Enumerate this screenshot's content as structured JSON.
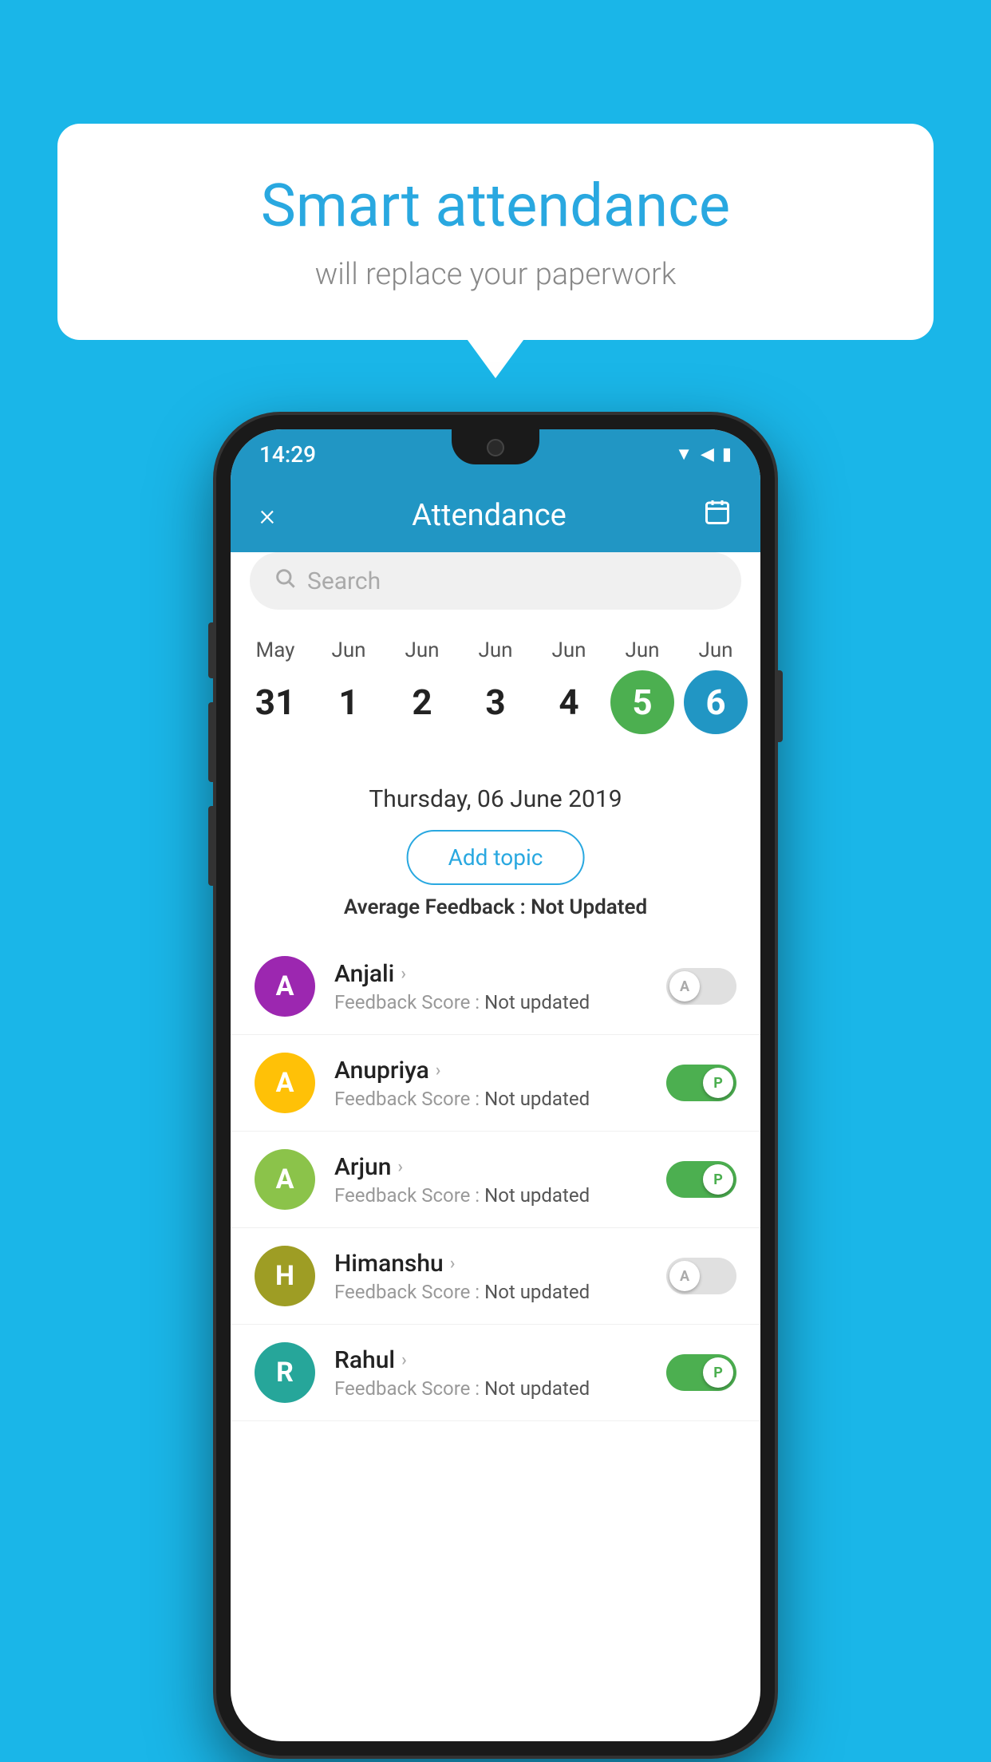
{
  "background_color": "#1ab6e8",
  "bubble": {
    "title": "Smart attendance",
    "subtitle": "will replace your paperwork"
  },
  "status_bar": {
    "time": "14:29",
    "icons": [
      "wifi",
      "signal",
      "battery"
    ]
  },
  "header": {
    "title": "Attendance",
    "close_label": "×"
  },
  "search": {
    "placeholder": "Search"
  },
  "calendar": {
    "days": [
      {
        "month": "May",
        "num": "31",
        "style": "normal"
      },
      {
        "month": "Jun",
        "num": "1",
        "style": "normal"
      },
      {
        "month": "Jun",
        "num": "2",
        "style": "normal"
      },
      {
        "month": "Jun",
        "num": "3",
        "style": "normal"
      },
      {
        "month": "Jun",
        "num": "4",
        "style": "normal"
      },
      {
        "month": "Jun",
        "num": "5",
        "style": "green"
      },
      {
        "month": "Jun",
        "num": "6",
        "style": "blue"
      }
    ]
  },
  "selected_date": "Thursday, 06 June 2019",
  "add_topic_label": "Add topic",
  "avg_feedback_label": "Average Feedback :",
  "avg_feedback_value": "Not Updated",
  "students": [
    {
      "name": "Anjali",
      "initial": "A",
      "avatar_color": "purple",
      "feedback_label": "Feedback Score :",
      "feedback_value": "Not updated",
      "toggle": "off",
      "toggle_label": "A"
    },
    {
      "name": "Anupriya",
      "initial": "A",
      "avatar_color": "yellow",
      "feedback_label": "Feedback Score :",
      "feedback_value": "Not updated",
      "toggle": "on",
      "toggle_label": "P"
    },
    {
      "name": "Arjun",
      "initial": "A",
      "avatar_color": "light-green",
      "feedback_label": "Feedback Score :",
      "feedback_value": "Not updated",
      "toggle": "on",
      "toggle_label": "P"
    },
    {
      "name": "Himanshu",
      "initial": "H",
      "avatar_color": "olive",
      "feedback_label": "Feedback Score :",
      "feedback_value": "Not updated",
      "toggle": "off",
      "toggle_label": "A"
    },
    {
      "name": "Rahul",
      "initial": "R",
      "avatar_color": "teal",
      "feedback_label": "Feedback Score :",
      "feedback_value": "Not updated",
      "toggle": "on",
      "toggle_label": "P"
    }
  ]
}
